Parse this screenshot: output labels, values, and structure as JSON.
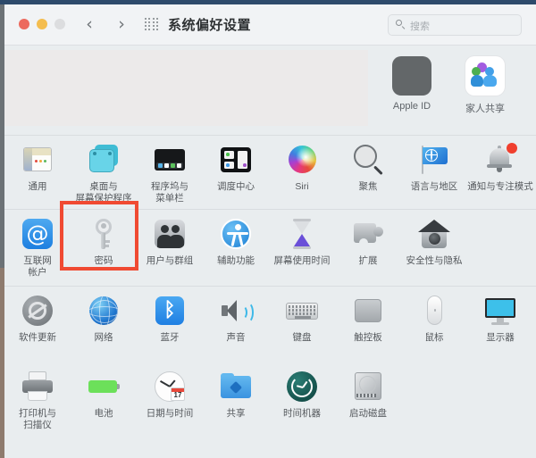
{
  "window": {
    "title": "系统偏好设置",
    "traffic_lights": [
      "close",
      "minimize",
      "zoom"
    ],
    "nav_back": "‹",
    "nav_forward": "›",
    "grid_icon": "grid-icon"
  },
  "search": {
    "placeholder": "搜索",
    "icon": "search-icon",
    "value": ""
  },
  "banner": {
    "items": [
      {
        "label": "Apple ID",
        "icon": "apple-logo-icon"
      },
      {
        "label": "家人共享",
        "icon": "family-sharing-icon"
      }
    ]
  },
  "rows": [
    {
      "items": [
        {
          "label": "通用",
          "icon": "general-icon"
        },
        {
          "label": "桌面与\n屏幕保护程序",
          "icon": "desktop-screensaver-icon"
        },
        {
          "label": "程序坞与\n菜单栏",
          "icon": "dock-menubar-icon"
        },
        {
          "label": "调度中心",
          "icon": "mission-control-icon"
        },
        {
          "label": "Siri",
          "icon": "siri-icon"
        },
        {
          "label": "聚焦",
          "icon": "spotlight-icon"
        },
        {
          "label": "语言与地区",
          "icon": "language-region-icon"
        },
        {
          "label": "通知与专注模式",
          "icon": "notifications-focus-icon"
        }
      ]
    },
    {
      "items": [
        {
          "label": "互联网\n帐户",
          "icon": "internet-accounts-icon"
        },
        {
          "label": "密码",
          "icon": "passwords-key-icon",
          "highlighted": true
        },
        {
          "label": "用户与群组",
          "icon": "users-groups-icon"
        },
        {
          "label": "辅助功能",
          "icon": "accessibility-icon"
        },
        {
          "label": "屏幕使用时间",
          "icon": "screen-time-icon"
        },
        {
          "label": "扩展",
          "icon": "extensions-icon"
        },
        {
          "label": "安全性与隐私",
          "icon": "security-privacy-icon"
        }
      ]
    },
    {
      "items": [
        {
          "label": "软件更新",
          "icon": "software-update-icon"
        },
        {
          "label": "网络",
          "icon": "network-icon"
        },
        {
          "label": "蓝牙",
          "icon": "bluetooth-icon"
        },
        {
          "label": "声音",
          "icon": "sound-icon"
        },
        {
          "label": "键盘",
          "icon": "keyboard-icon"
        },
        {
          "label": "触控板",
          "icon": "trackpad-icon"
        },
        {
          "label": "鼠标",
          "icon": "mouse-icon"
        },
        {
          "label": "显示器",
          "icon": "displays-icon"
        }
      ]
    },
    {
      "items": [
        {
          "label": "打印机与\n扫描仪",
          "icon": "printers-scanners-icon"
        },
        {
          "label": "电池",
          "icon": "battery-icon"
        },
        {
          "label": "日期与时间",
          "icon": "date-time-icon"
        },
        {
          "label": "共享",
          "icon": "sharing-icon"
        },
        {
          "label": "时间机器",
          "icon": "time-machine-icon"
        },
        {
          "label": "启动磁盘",
          "icon": "startup-disk-icon"
        }
      ]
    }
  ],
  "annotation": {
    "highlight_color": "#f04a32",
    "highlight_target": "密码"
  },
  "date_time_icon": {
    "day": "17"
  },
  "glyphs": {
    "apple": "",
    "bluetooth": "ᛒ",
    "at": "@"
  }
}
